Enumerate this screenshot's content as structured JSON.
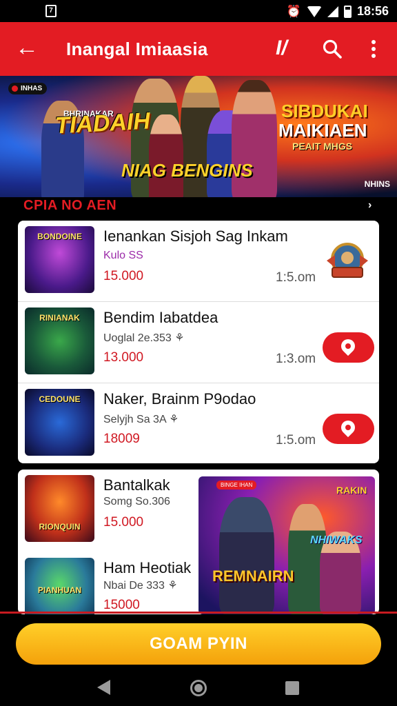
{
  "status_bar": {
    "left_glyph": "7",
    "time": "18:56",
    "icons": [
      "alarm-icon",
      "wifi-icon",
      "signal-icon",
      "battery-icon"
    ]
  },
  "app_bar": {
    "title": "Inangal Imiaasia",
    "brand_glyph": "I/",
    "icons": [
      "back-arrow-icon",
      "brand-icon",
      "search-icon",
      "more-vert-icon"
    ]
  },
  "banner": {
    "badge": "INHAS",
    "left_sub": "BHRINAKAR",
    "left_title": "TIADAIH",
    "center_title": "NIAG BENGINS",
    "right_line_1": "SIBDUKAI",
    "right_line_2": "MAIKIAEN",
    "right_line_3": "PEAIT MHGS",
    "corner_tag": "NHINS"
  },
  "section": {
    "title": "CPIA NO AEN",
    "arrow": "›"
  },
  "listings": [
    {
      "thumb_label": "BONDOINE",
      "title": "Ienankan Sisjoh Sag Inkam",
      "subtitle": "Kulo SS",
      "price": "15.000",
      "time": "1:5.om",
      "trailing": "emblem"
    },
    {
      "thumb_label": "RINIANAK",
      "title": "Bendim Iabatdea",
      "subtitle": "Uoglal 2e.353 ⚘",
      "price": "13.000",
      "time": "1:3.om",
      "trailing": "map-button"
    },
    {
      "thumb_label": "CEDOUNE",
      "title": "Naker, Brainm P9odao",
      "subtitle": "Selyjh Sa 3A ⚘",
      "price": "18009",
      "time": "1:5.om",
      "trailing": "map-button"
    }
  ],
  "listings_2": [
    {
      "thumb_label": "RIONQUIN",
      "title": "Bantalkak",
      "subtitle": "Somg So.306",
      "price": "15.000"
    },
    {
      "thumb_label": "PIANHUAN",
      "title": "Ham Heotiak",
      "subtitle": "Nbai De 333 ⚘",
      "price": "15000"
    }
  ],
  "promo": {
    "tag": "BINGE IHAN",
    "title_1": "RAKIN",
    "title_2": "NHIWAKS",
    "title_3": "REMNAIRN"
  },
  "cta": {
    "label": "GOAM PYIN"
  },
  "colors": {
    "primary_red": "#e31c23",
    "cta_yellow": "#f8b81a",
    "price_red": "#d01822"
  }
}
